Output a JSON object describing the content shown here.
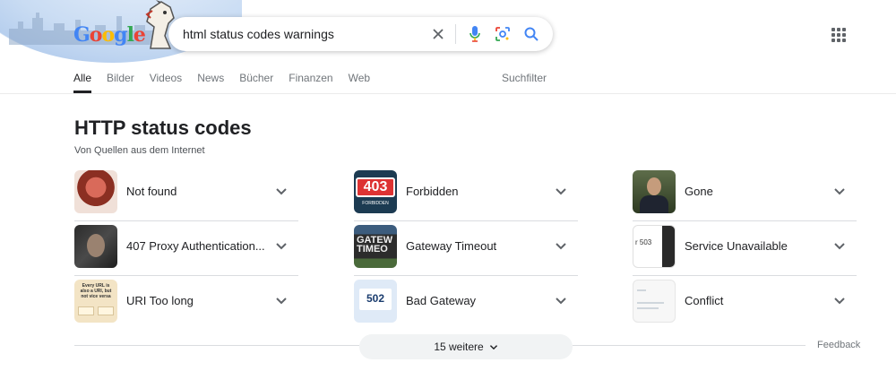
{
  "search": {
    "query": "html status codes warnings"
  },
  "icons": {
    "clear": "close-icon",
    "voice": "microphone-icon",
    "lens": "lens-icon",
    "search": "search-icon",
    "apps": "apps-grid-icon"
  },
  "tabs": [
    {
      "label": "Alle",
      "active": true
    },
    {
      "label": "Bilder"
    },
    {
      "label": "Videos"
    },
    {
      "label": "News"
    },
    {
      "label": "Bücher"
    },
    {
      "label": "Finanzen"
    },
    {
      "label": "Web"
    }
  ],
  "tools_label": "Suchfilter",
  "panel": {
    "title": "HTTP status codes",
    "subtitle": "Von Quellen aus dem Internet",
    "columns": [
      [
        {
          "label": "Not found"
        },
        {
          "label": "407 Proxy Authentication..."
        },
        {
          "label": "URI Too long",
          "thumb_text": "Every URL is also a URI, but not vice versa"
        }
      ],
      [
        {
          "label": "Forbidden",
          "thumb_text": "403",
          "thumb_sub": "FORBIDDEN"
        },
        {
          "label": "Gateway Timeout",
          "thumb_text": "GATEW TIMEO"
        },
        {
          "label": "Bad Gateway",
          "thumb_text": "502"
        }
      ],
      [
        {
          "label": "Gone"
        },
        {
          "label": "Service Unavailable",
          "thumb_text": "r 503"
        },
        {
          "label": "Conflict"
        }
      ]
    ]
  },
  "more_label": "15 weitere",
  "feedback_label": "Feedback",
  "colors": {
    "text": "#202124",
    "muted": "#70757a",
    "blue": "#4285f4",
    "red": "#ea4335",
    "yellow": "#fbbc05",
    "green": "#34a853"
  }
}
